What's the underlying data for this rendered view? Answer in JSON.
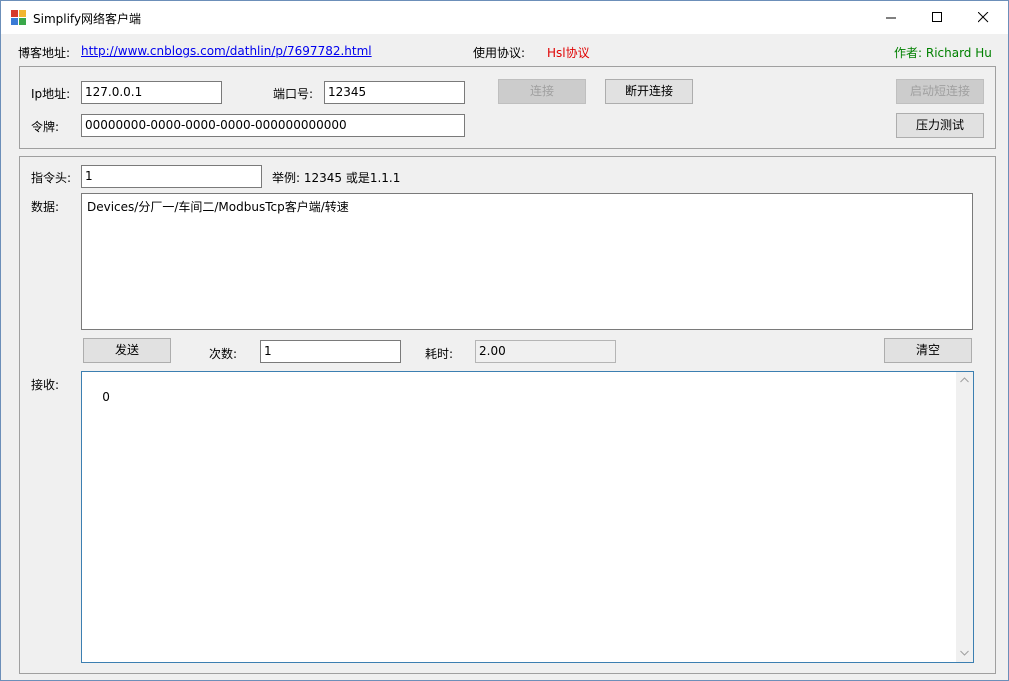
{
  "window": {
    "title": "Simplify网络客户端"
  },
  "header": {
    "blog_label": "博客地址:",
    "blog_link": "http://www.cnblogs.com/dathlin/p/7697782.html",
    "protocol_label": "使用协议:",
    "protocol_value": "Hsl协议",
    "author": "作者: Richard Hu"
  },
  "connection": {
    "ip_label": "Ip地址:",
    "ip_value": "127.0.0.1",
    "port_label": "端口号:",
    "port_value": "12345",
    "token_label": "令牌:",
    "token_value": "00000000-0000-0000-0000-000000000000",
    "connect_button": "连接",
    "disconnect_button": "断开连接",
    "short_conn_button": "启动短连接",
    "stress_test_button": "压力测试"
  },
  "message": {
    "head_label": "指令头:",
    "head_value": "1",
    "example_text": "举例: 12345 或是1.1.1",
    "data_label": "数据:",
    "data_value": "Devices/分厂一/车间二/ModbusTcp客户端/转速",
    "send_button": "发送",
    "count_label": "次数:",
    "count_value": "1",
    "time_label": "耗时:",
    "time_value": "2.00",
    "clear_button": "清空",
    "receive_label": "接收:",
    "receive_value": "0"
  },
  "colors": {
    "link": "#0000ee",
    "protocol": "#e00000",
    "author": "#008000",
    "border": "#6c8fb9"
  }
}
